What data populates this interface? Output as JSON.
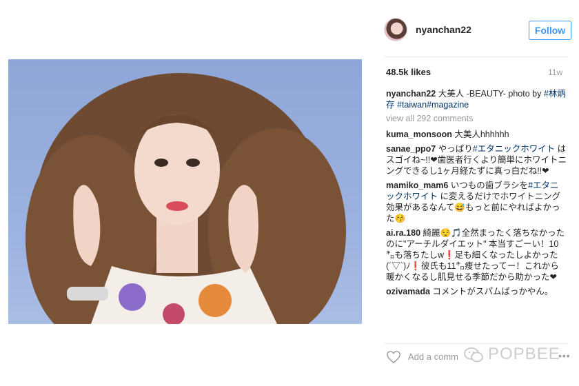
{
  "post": {
    "username": "nyanchan22",
    "follow_label": "Follow",
    "likes": "48.5k likes",
    "timestamp": "11w",
    "caption": {
      "user": "nyanchan22",
      "text_1": " 大美人 -BEAUTY- photo by ",
      "tag_1": "#林炳存",
      "tag_2": "#taiwan",
      "tag_3": "#magazine"
    },
    "view_all": "view all 292 comments",
    "comments": [
      {
        "user": "kuma_monsoon",
        "text": " 大美人hhhhhh"
      },
      {
        "user": "sanae_ppo7",
        "text_a": " やっぱり",
        "tag": "#エタニックホワイト",
        "text_b": " はスゴイね~!!❤歯医者行くより簡単にホワイトニングできるし1ヶ月経たずに真っ白だね!!❤"
      },
      {
        "user": "mamiko_mam6",
        "text_a": " いつもの歯ブラシを",
        "tag": "#エタニックホワイト",
        "text_b": " に変えるだけでホワイトニング効果があるなんて😅もっと前にやればよかった😚"
      },
      {
        "user": "ai.ra.180",
        "text": " 綺麗😌🎵全然まったく落ちなかったのに\"アーチルダイエット\" 本当すごーい！10㌔も落ちたしw❗️足も細くなったしよかった(´▽`)ﾉ❗️彼氏も11㌔痩せたってー！これから暖かくなるし肌見せる季節だから助かった❤"
      },
      {
        "user": "ozivamada",
        "text": " コメントがスパムばっかやん。"
      }
    ],
    "add_comment_placeholder": "Add a comm",
    "more_label": "•••"
  },
  "watermark": {
    "text": "POPBEE"
  },
  "icons": {
    "like": "heart-icon",
    "more": "more-options-icon",
    "watermark": "wechat-icon"
  },
  "colors": {
    "accent": "#3897f0",
    "hashtag": "#003569",
    "muted": "#999999",
    "photo_bg": "#9bb1df"
  }
}
